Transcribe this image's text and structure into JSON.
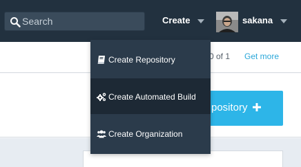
{
  "navbar": {
    "search": {
      "placeholder": "Search",
      "value": ""
    },
    "create_label": "Create",
    "username": "sakana"
  },
  "dropdown": {
    "items": [
      {
        "label": "Create Repository",
        "icon": "book-icon"
      },
      {
        "label": "Create Automated Build",
        "icon": "gears-icon"
      },
      {
        "label": "Create Organization",
        "icon": "users-icon"
      }
    ]
  },
  "subbar": {
    "pagination_text": "0 of 1",
    "get_more": "Get more"
  },
  "cta": {
    "label": "pository",
    "icon": "plus-icon"
  },
  "colors": {
    "navbar": "#22313f",
    "dropdown": "#2b3b4b",
    "dropdown_active": "#1d2935",
    "cta": "#2db5e8",
    "link": "#2aa7d9"
  }
}
